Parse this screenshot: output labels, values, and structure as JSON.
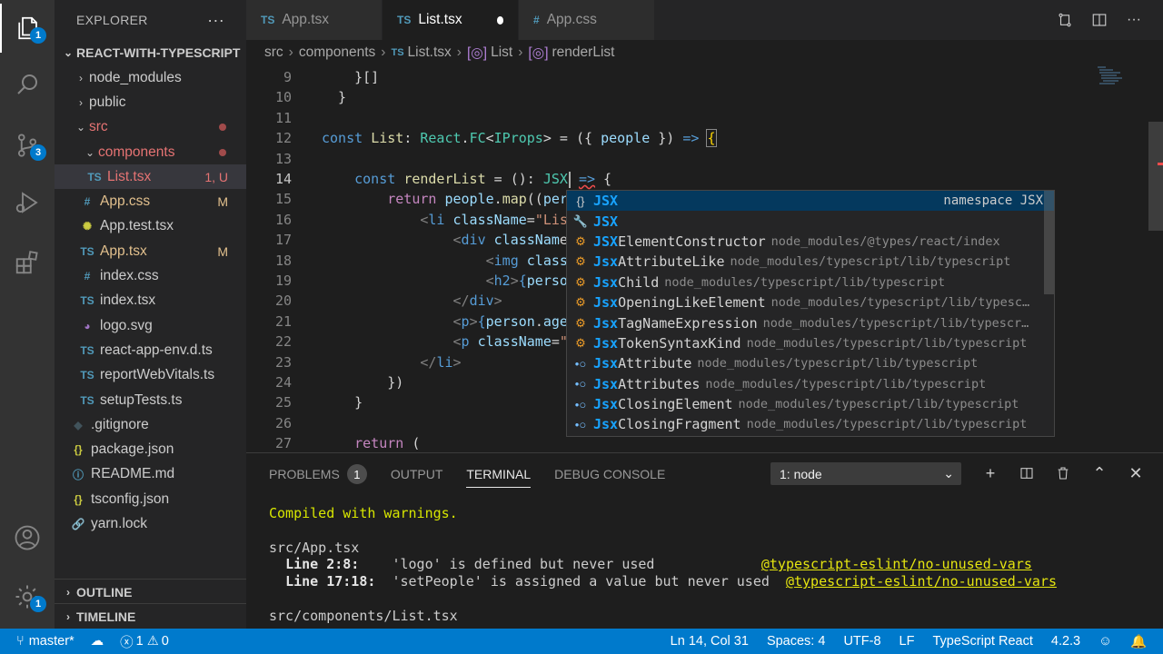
{
  "activity": {
    "explorer_badge": "1",
    "scm_badge": "3",
    "settings_badge": "1"
  },
  "sidebar": {
    "title": "EXPLORER",
    "more": "···",
    "project": "REACT-WITH-TYPESCRIPT",
    "items": [
      {
        "label": "node_modules",
        "type": "folder-closed",
        "indent": 1
      },
      {
        "label": "public",
        "type": "folder-closed",
        "indent": 1
      },
      {
        "label": "src",
        "type": "folder-open",
        "indent": 1,
        "dot": true
      },
      {
        "label": "components",
        "type": "folder-open",
        "indent": 2,
        "dot": true
      },
      {
        "label": "List.tsx",
        "type": "ts",
        "indent": 3,
        "decoration": "1, U",
        "selected": true
      },
      {
        "label": "App.css",
        "type": "css",
        "indent": 2,
        "decoration": "M"
      },
      {
        "label": "App.test.tsx",
        "type": "test",
        "indent": 2
      },
      {
        "label": "App.tsx",
        "type": "ts",
        "indent": 2,
        "decoration": "M"
      },
      {
        "label": "index.css",
        "type": "css",
        "indent": 2
      },
      {
        "label": "index.tsx",
        "type": "ts",
        "indent": 2
      },
      {
        "label": "logo.svg",
        "type": "svg",
        "indent": 2
      },
      {
        "label": "react-app-env.d.ts",
        "type": "ts",
        "indent": 2
      },
      {
        "label": "reportWebVitals.ts",
        "type": "ts",
        "indent": 2
      },
      {
        "label": "setupTests.ts",
        "type": "ts",
        "indent": 2
      },
      {
        "label": ".gitignore",
        "type": "git",
        "indent": 1
      },
      {
        "label": "package.json",
        "type": "json",
        "indent": 1
      },
      {
        "label": "README.md",
        "type": "info",
        "indent": 1
      },
      {
        "label": "tsconfig.json",
        "type": "json",
        "indent": 1
      },
      {
        "label": "yarn.lock",
        "type": "yarn",
        "indent": 1
      }
    ],
    "outline": "OUTLINE",
    "timeline": "TIMELINE"
  },
  "tabs": [
    {
      "icon": "TS",
      "label": "App.tsx",
      "active": false
    },
    {
      "icon": "TS",
      "label": "List.tsx",
      "active": true,
      "dirty": true
    },
    {
      "icon": "#",
      "label": "App.css",
      "active": false
    }
  ],
  "breadcrumb": [
    "src",
    "components",
    "List.tsx",
    "List",
    "renderList"
  ],
  "editor": {
    "line_numbers": [
      "9",
      "10",
      "11",
      "12",
      "13",
      "14",
      "15",
      "16",
      "17",
      "18",
      "19",
      "20",
      "21",
      "22",
      "23",
      "24",
      "25",
      "26",
      "27"
    ],
    "current_line": "14"
  },
  "suggest": {
    "items": [
      {
        "icon": "{}",
        "match": "JSX",
        "rest": "",
        "detail": "",
        "right": "namespace JSX",
        "selected": true
      },
      {
        "icon": "wrench",
        "match": "JSX",
        "rest": "",
        "detail": ""
      },
      {
        "icon": "class",
        "match": "JSX",
        "rest": "ElementConstructor",
        "detail": "node_modules/@types/react/index"
      },
      {
        "icon": "class",
        "match": "Jsx",
        "rest": "AttributeLike",
        "detail": "node_modules/typescript/lib/typescript"
      },
      {
        "icon": "class",
        "match": "Jsx",
        "rest": "Child",
        "detail": "node_modules/typescript/lib/typescript"
      },
      {
        "icon": "class",
        "match": "Jsx",
        "rest": "OpeningLikeElement",
        "detail": "node_modules/typescript/lib/typesc…"
      },
      {
        "icon": "class",
        "match": "Jsx",
        "rest": "TagNameExpression",
        "detail": "node_modules/typescript/lib/typescr…"
      },
      {
        "icon": "class",
        "match": "Jsx",
        "rest": "TokenSyntaxKind",
        "detail": "node_modules/typescript/lib/typescript"
      },
      {
        "icon": "interface",
        "match": "Jsx",
        "rest": "Attribute",
        "detail": "node_modules/typescript/lib/typescript"
      },
      {
        "icon": "interface",
        "match": "Jsx",
        "rest": "Attributes",
        "detail": "node_modules/typescript/lib/typescript"
      },
      {
        "icon": "interface",
        "match": "Jsx",
        "rest": "ClosingElement",
        "detail": "node_modules/typescript/lib/typescript"
      },
      {
        "icon": "interface",
        "match": "Jsx",
        "rest": "ClosingFragment",
        "detail": "node_modules/typescript/lib/typescript"
      }
    ]
  },
  "panel": {
    "tabs": [
      {
        "label": "PROBLEMS",
        "badge": "1"
      },
      {
        "label": "OUTPUT"
      },
      {
        "label": "TERMINAL",
        "active": true
      },
      {
        "label": "DEBUG CONSOLE"
      }
    ],
    "terminal_select": "1: node",
    "terminal": {
      "compiled": "Compiled with warnings.",
      "file1": "src/App.tsx",
      "w1_loc": "Line 2:8:",
      "w1_msg": "'logo' is defined but never used",
      "w1_rule": "@typescript-eslint/no-unused-vars",
      "w2_loc": "Line 17:18:",
      "w2_msg": "'setPeople' is assigned a value but never used",
      "w2_rule": "@typescript-eslint/no-unused-vars",
      "file2": "src/components/List.tsx"
    }
  },
  "status": {
    "branch": "master*",
    "errors": "1",
    "warnings": "0",
    "position": "Ln 14, Col 31",
    "spaces": "Spaces: 4",
    "encoding": "UTF-8",
    "eol": "LF",
    "language": "TypeScript React",
    "version": "4.2.3"
  }
}
